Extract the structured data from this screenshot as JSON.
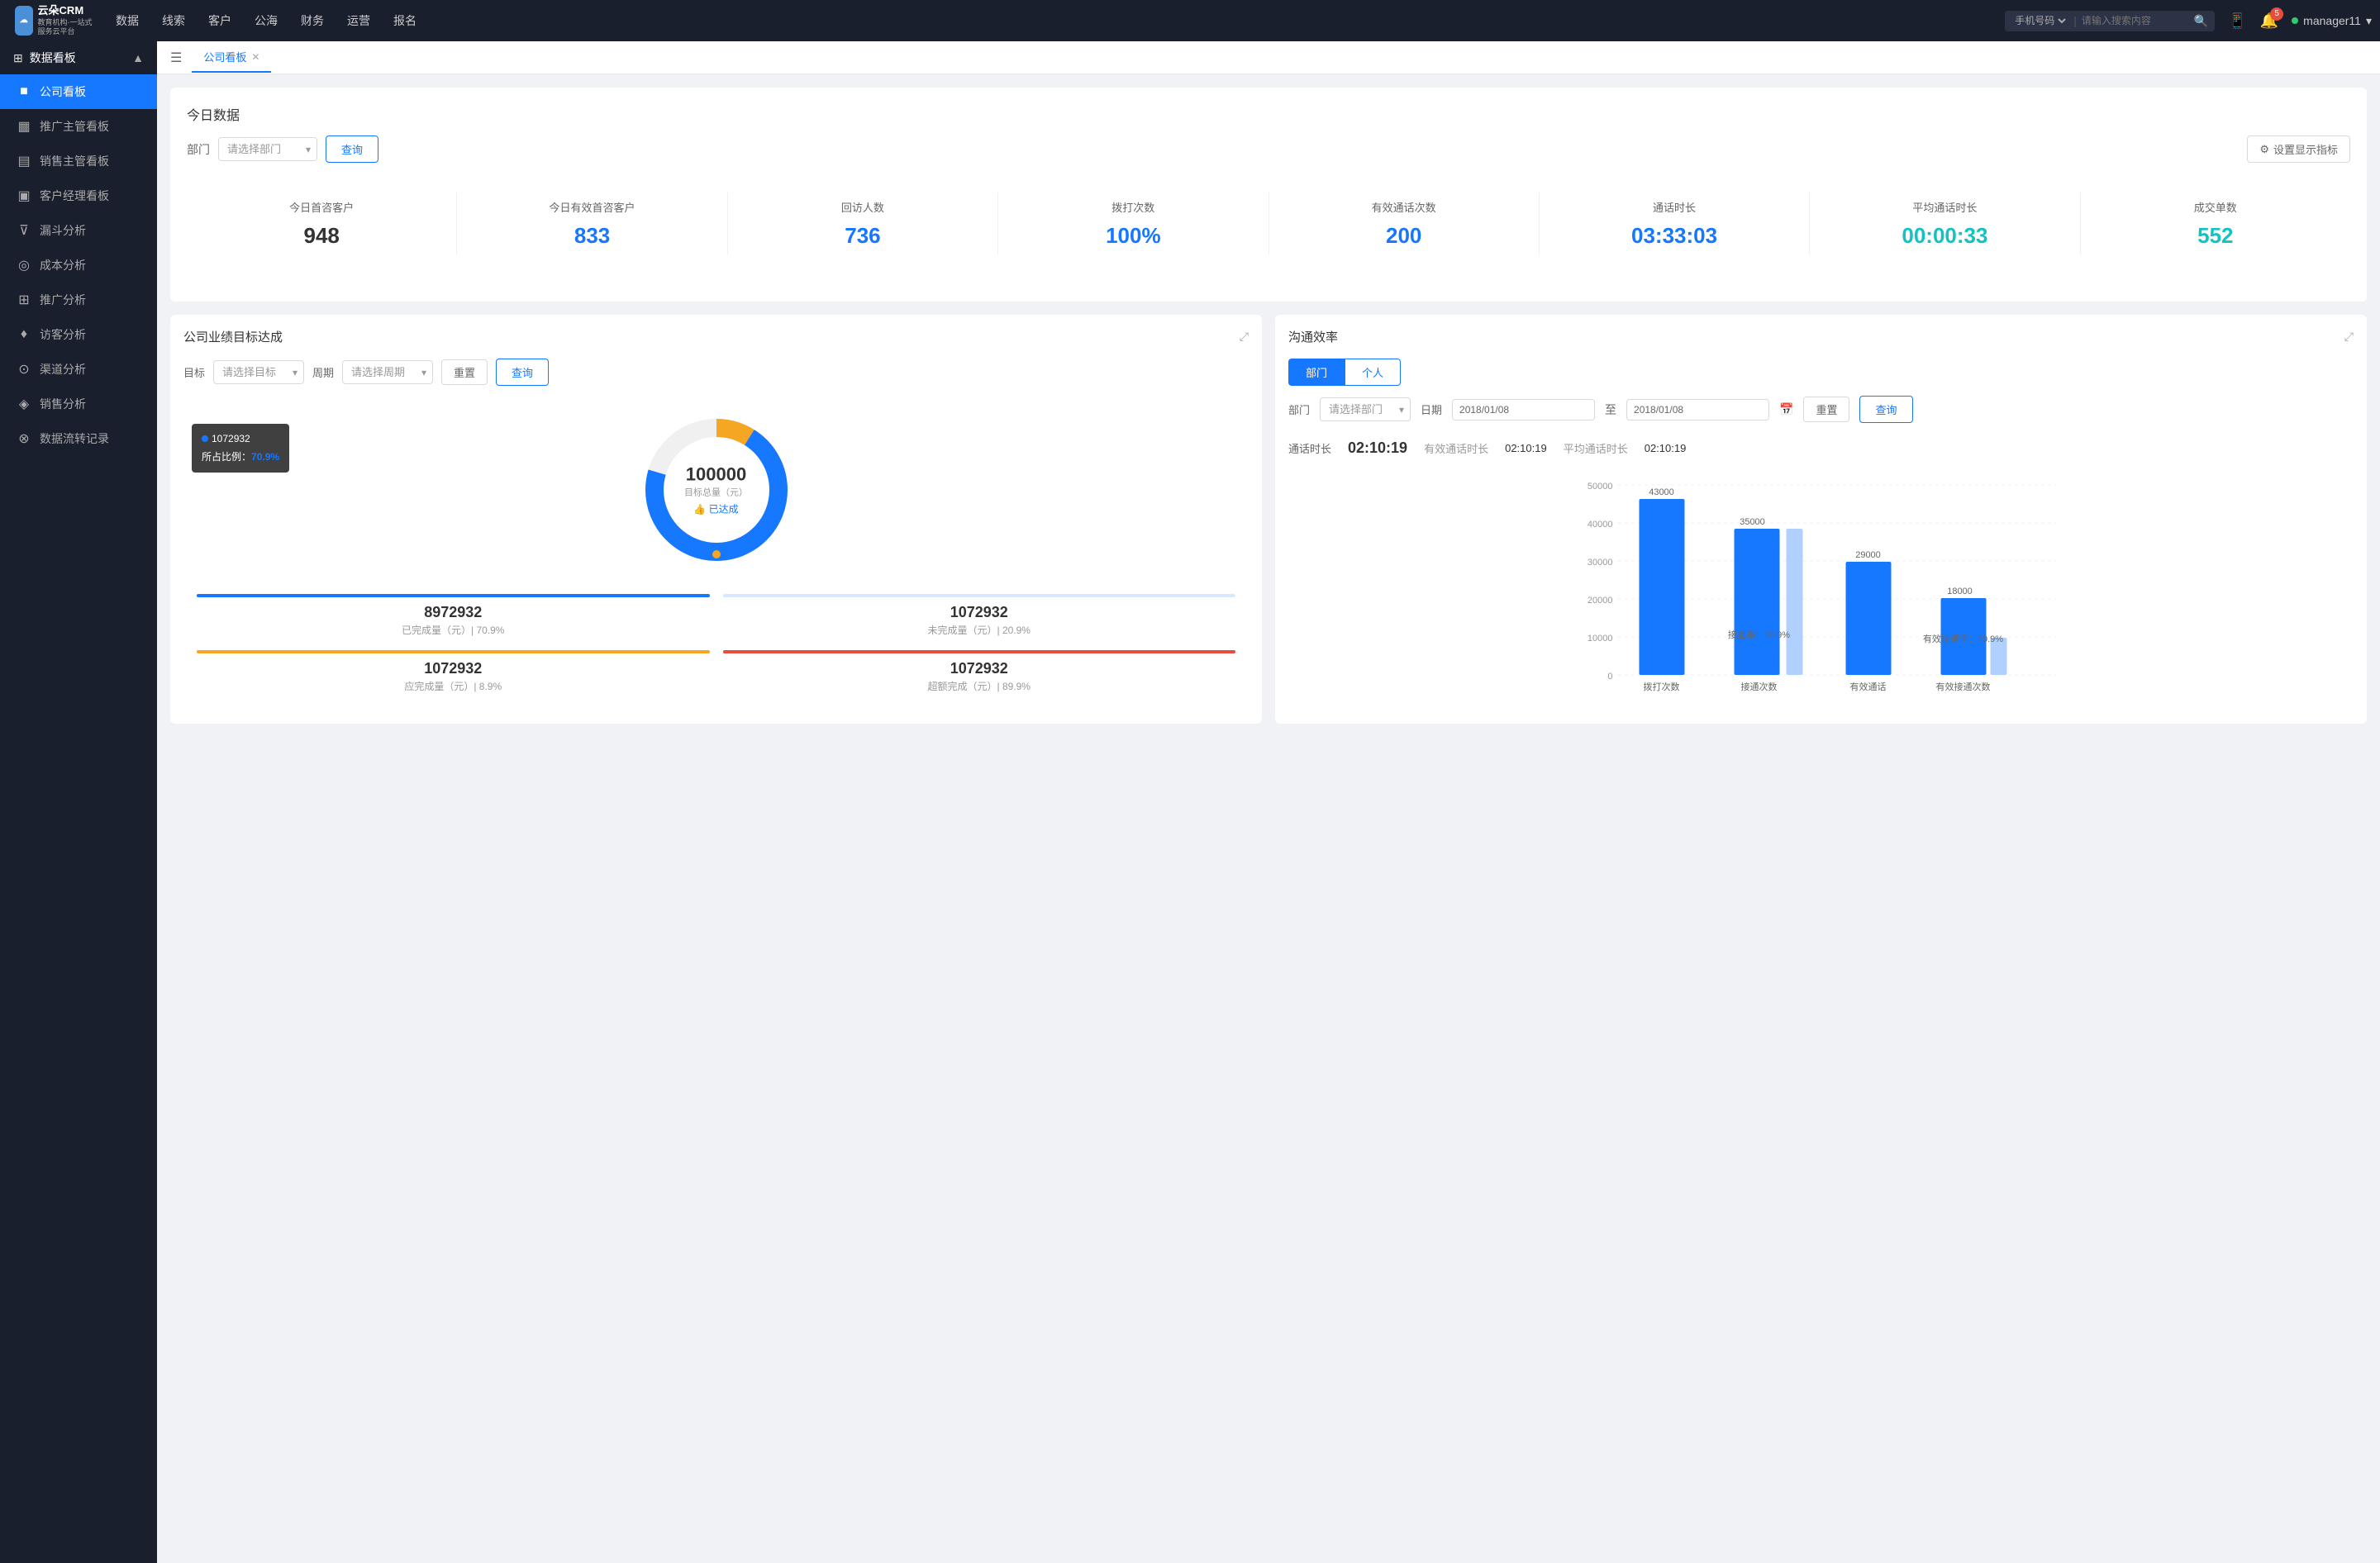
{
  "topnav": {
    "logo_line1": "云朵CRM",
    "logo_line2": "教育机构·一站式服务云平台",
    "nav_items": [
      "数据",
      "线索",
      "客户",
      "公海",
      "财务",
      "运营",
      "报名"
    ],
    "search_placeholder": "请输入搜索内容",
    "search_type": "手机号码",
    "notifications": "5",
    "username": "manager11"
  },
  "sidebar": {
    "section_label": "数据看板",
    "items": [
      {
        "label": "公司看板",
        "icon": "■",
        "active": true
      },
      {
        "label": "推广主管看板",
        "icon": "▦",
        "active": false
      },
      {
        "label": "销售主管看板",
        "icon": "▤",
        "active": false
      },
      {
        "label": "客户经理看板",
        "icon": "▣",
        "active": false
      },
      {
        "label": "漏斗分析",
        "icon": "⊽",
        "active": false
      },
      {
        "label": "成本分析",
        "icon": "◎",
        "active": false
      },
      {
        "label": "推广分析",
        "icon": "⊞",
        "active": false
      },
      {
        "label": "访客分析",
        "icon": "♦",
        "active": false
      },
      {
        "label": "渠道分析",
        "icon": "⊙",
        "active": false
      },
      {
        "label": "销售分析",
        "icon": "◈",
        "active": false
      },
      {
        "label": "数据流转记录",
        "icon": "⊗",
        "active": false
      }
    ]
  },
  "tab_bar": {
    "tab_label": "公司看板"
  },
  "today_section": {
    "title": "今日数据",
    "dept_label": "部门",
    "dept_placeholder": "请选择部门",
    "query_btn": "查询",
    "settings_btn": "设置显示指标",
    "stats": [
      {
        "label": "今日首咨客户",
        "value": "948",
        "color": "dark"
      },
      {
        "label": "今日有效首咨客户",
        "value": "833",
        "color": "blue"
      },
      {
        "label": "回访人数",
        "value": "736",
        "color": "blue"
      },
      {
        "label": "拨打次数",
        "value": "100%",
        "color": "blue"
      },
      {
        "label": "有效通话次数",
        "value": "200",
        "color": "blue"
      },
      {
        "label": "通话时长",
        "value": "03:33:03",
        "color": "blue"
      },
      {
        "label": "平均通话时长",
        "value": "00:00:33",
        "color": "cyan"
      },
      {
        "label": "成交单数",
        "value": "552",
        "color": "cyan"
      }
    ]
  },
  "perf_panel": {
    "title": "公司业绩目标达成",
    "target_label": "目标",
    "target_placeholder": "请选择目标",
    "period_label": "周期",
    "period_placeholder": "请选择周期",
    "reset_btn": "重置",
    "query_btn": "查询",
    "donut": {
      "center_value": "100000",
      "center_sub": "目标总量（元）",
      "achieved_label": "👍 已达成",
      "tooltip_value": "1072932",
      "tooltip_percent_label": "所占比例：",
      "tooltip_percent": "70.9%"
    },
    "legend": [
      {
        "label": "8972932",
        "desc": "已完成量（元）| 70.9%",
        "color": "#1677ff"
      },
      {
        "label": "1072932",
        "desc": "未完成量（元）| 20.9%",
        "color": "#d9e8ff"
      },
      {
        "label": "1072932",
        "desc": "应完成量（元）| 8.9%",
        "color": "#f5a623"
      },
      {
        "label": "1072932",
        "desc": "超额完成（元）| 89.9%",
        "color": "#e74c3c"
      }
    ]
  },
  "comm_panel": {
    "title": "沟通效率",
    "tabs": [
      "部门",
      "个人"
    ],
    "active_tab": "部门",
    "dept_label": "部门",
    "dept_placeholder": "请选择部门",
    "date_label": "日期",
    "date_from": "2018/01/08",
    "date_to": "2018/01/08",
    "reset_btn": "重置",
    "query_btn": "查询",
    "stats": {
      "talk_label": "通话时长",
      "talk_value": "02:10:19",
      "eff_label": "有效通话时长",
      "eff_value": "02:10:19",
      "avg_label": "平均通话时长",
      "avg_value": "02:10:19"
    },
    "chart": {
      "y_labels": [
        "50000",
        "40000",
        "30000",
        "20000",
        "10000",
        "0"
      ],
      "bars": [
        {
          "group": "拨打次数",
          "val1": 43000,
          "val2": 0,
          "label1": "43000",
          "label2": "",
          "rate": ""
        },
        {
          "group": "接通次数",
          "val1": 35000,
          "val2": 0,
          "label1": "35000",
          "label2": "",
          "rate": "接通率：70.9%"
        },
        {
          "group": "有效通话",
          "val1": 29000,
          "val2": 0,
          "label1": "29000",
          "label2": "",
          "rate": ""
        },
        {
          "group": "有效接通次数",
          "val1": 18000,
          "val2": 5000,
          "label1": "18000",
          "label2": "",
          "rate": "有效接通率：70.9%"
        }
      ]
    }
  }
}
